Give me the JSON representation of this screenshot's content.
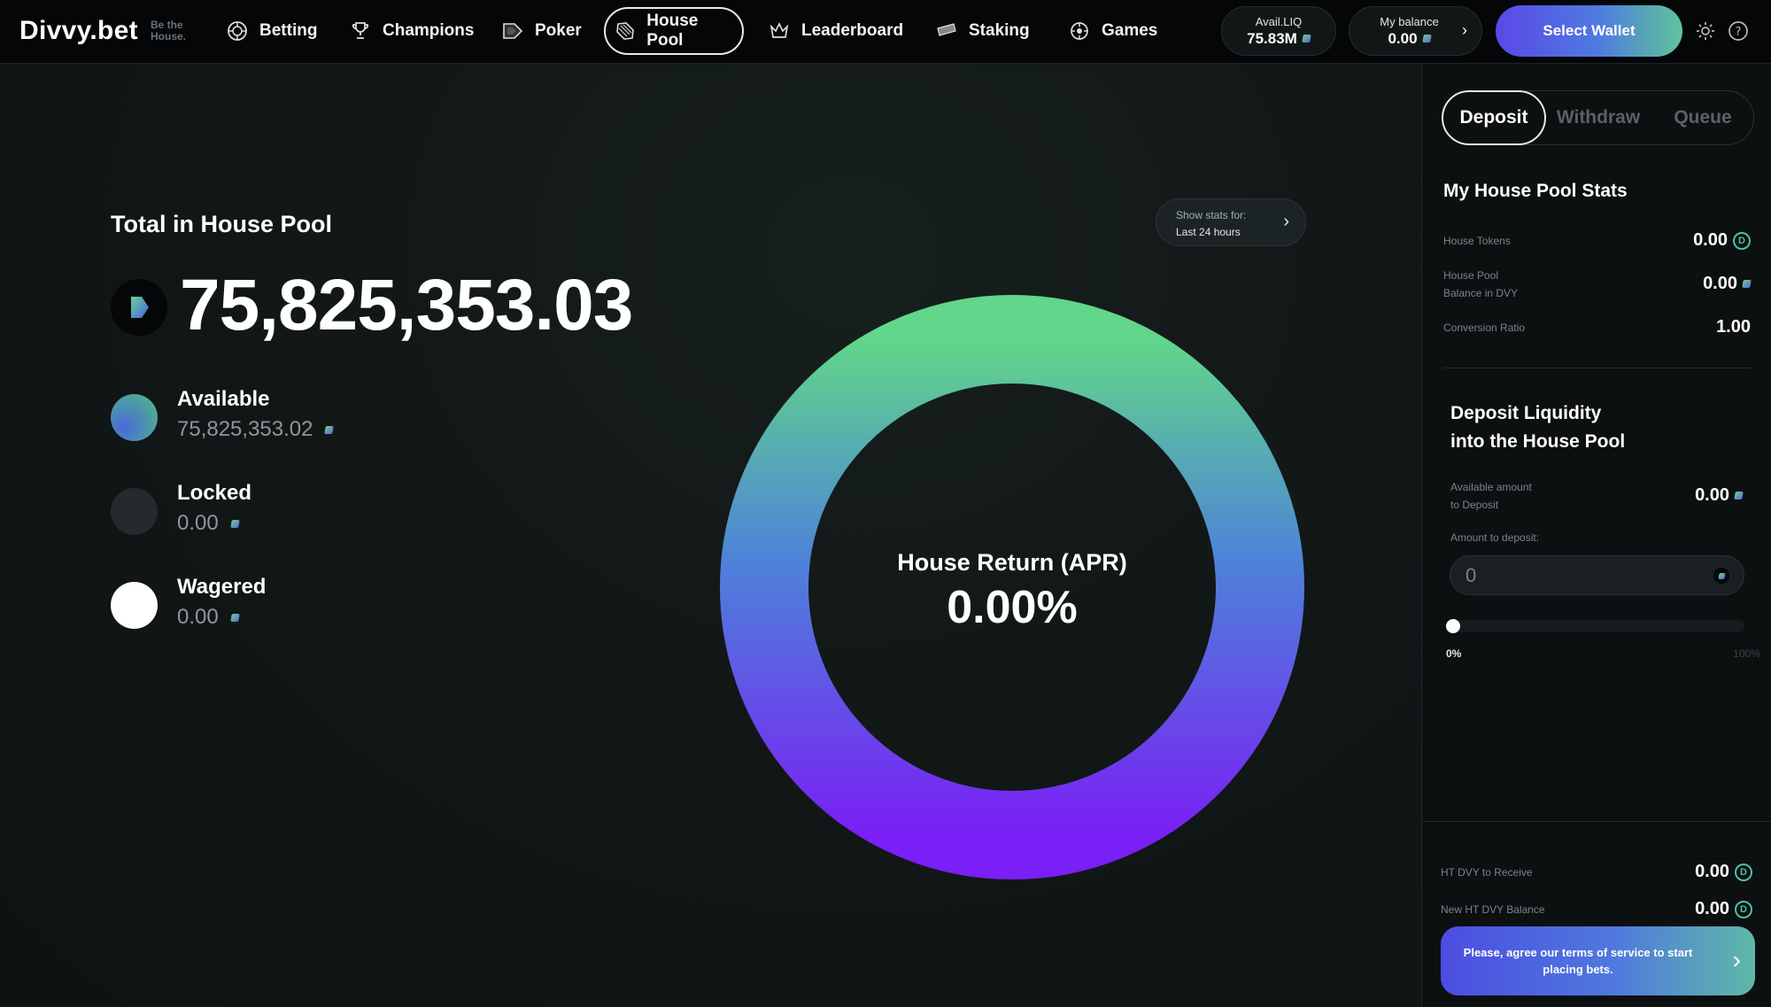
{
  "header": {
    "logo": "Divvy.bet",
    "tagline_line1": "Be the",
    "tagline_line2": "House.",
    "nav": [
      {
        "label": "Betting",
        "icon": "roulette-wheel-icon"
      },
      {
        "label": "Champions",
        "icon": "trophy-icon"
      },
      {
        "label": "Poker",
        "icon": "poker-cards-icon"
      },
      {
        "label": "House Pool",
        "icon": "house-pool-icon",
        "active": true
      },
      {
        "label": "Leaderboard",
        "icon": "crown-icon"
      },
      {
        "label": "Staking",
        "icon": "ticket-icon"
      },
      {
        "label": "Games",
        "icon": "dice-icon"
      }
    ],
    "avail_liq": {
      "label": "Avail.LIQ",
      "value": "75.83M"
    },
    "my_balance": {
      "label": "My balance",
      "value": "0.00"
    },
    "select_wallet": "Select Wallet"
  },
  "main": {
    "title": "Total in House Pool",
    "total": "75,825,353.03",
    "legend": [
      {
        "name": "Available",
        "amount": "75,825,353.02",
        "color": "gradient-teal-blue"
      },
      {
        "name": "Locked",
        "amount": "0.00",
        "color": "#262a2c"
      },
      {
        "name": "Wagered",
        "amount": "0.00",
        "color": "#ffffff"
      }
    ],
    "stats_for": {
      "label": "Show stats for:",
      "value": "Last 24 hours"
    },
    "apr": {
      "label": "House Return (APR)",
      "value": "0.00%"
    }
  },
  "side": {
    "tabs": [
      "Deposit",
      "Withdraw",
      "Queue"
    ],
    "active_tab": "Deposit",
    "stats_title": "My House Pool Stats",
    "stats": [
      {
        "label": "House Tokens",
        "value": "0.00",
        "icon": "d-badge-icon"
      },
      {
        "label_line1": "House Pool",
        "label_line2": "Balance in DVY",
        "value": "0.00",
        "icon": "dvy-token-icon"
      },
      {
        "label": "Conversion Ratio",
        "value": "1.00"
      }
    ],
    "deposit_title_line1": "Deposit Liquidity",
    "deposit_title_line2": "into the House Pool",
    "available_label_line1": "Available amount",
    "available_label_line2": "to Deposit",
    "available_value": "0.00",
    "amount_label": "Amount to deposit:",
    "amount_value": "0",
    "slider_min": "0%",
    "slider_max": "100%",
    "slider_value": 0,
    "ht_receive_label": "HT DVY to Receive",
    "ht_receive_value": "0.00",
    "new_balance_label": "New HT DVY Balance",
    "new_balance_value": "0.00",
    "terms_text": "Please, agree our terms of service to start placing bets."
  },
  "colors": {
    "donut_top": "#62d68a",
    "donut_mid": "#4d82d9",
    "donut_bottom": "#7a1ff5",
    "wallet_gradient_start": "#5a48e8",
    "wallet_gradient_end": "#5fc49a"
  }
}
